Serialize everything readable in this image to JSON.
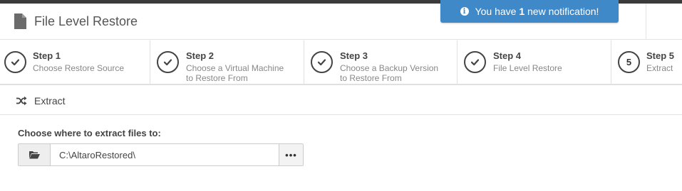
{
  "header": {
    "title": "File Level Restore",
    "doc_icon": "file-icon"
  },
  "notification": {
    "prefix": "You have ",
    "count": "1",
    "suffix": " new notification!",
    "icon": "info-icon",
    "color": "#3f89c9"
  },
  "wizard": {
    "steps": [
      {
        "title": "Step 1",
        "desc_line1": "Choose Restore Source",
        "desc_line2": "",
        "state": "done"
      },
      {
        "title": "Step 2",
        "desc_line1": "Choose a Virtual Machine",
        "desc_line2": "to Restore From",
        "state": "done"
      },
      {
        "title": "Step 3",
        "desc_line1": "Choose a Backup Version",
        "desc_line2": "to Restore From",
        "state": "done"
      },
      {
        "title": "Step 4",
        "desc_line1": "File Level Restore",
        "desc_line2": "",
        "state": "done"
      },
      {
        "title": "Step 5",
        "desc_line1": "Extract",
        "desc_line2": "",
        "state": "current",
        "number": "5"
      }
    ]
  },
  "section": {
    "title": "Extract",
    "icon": "shuffle-icon"
  },
  "extract": {
    "label": "Choose where to extract files to:",
    "path_value": "C:\\AltaroRestored\\",
    "browse_label": "•••"
  }
}
